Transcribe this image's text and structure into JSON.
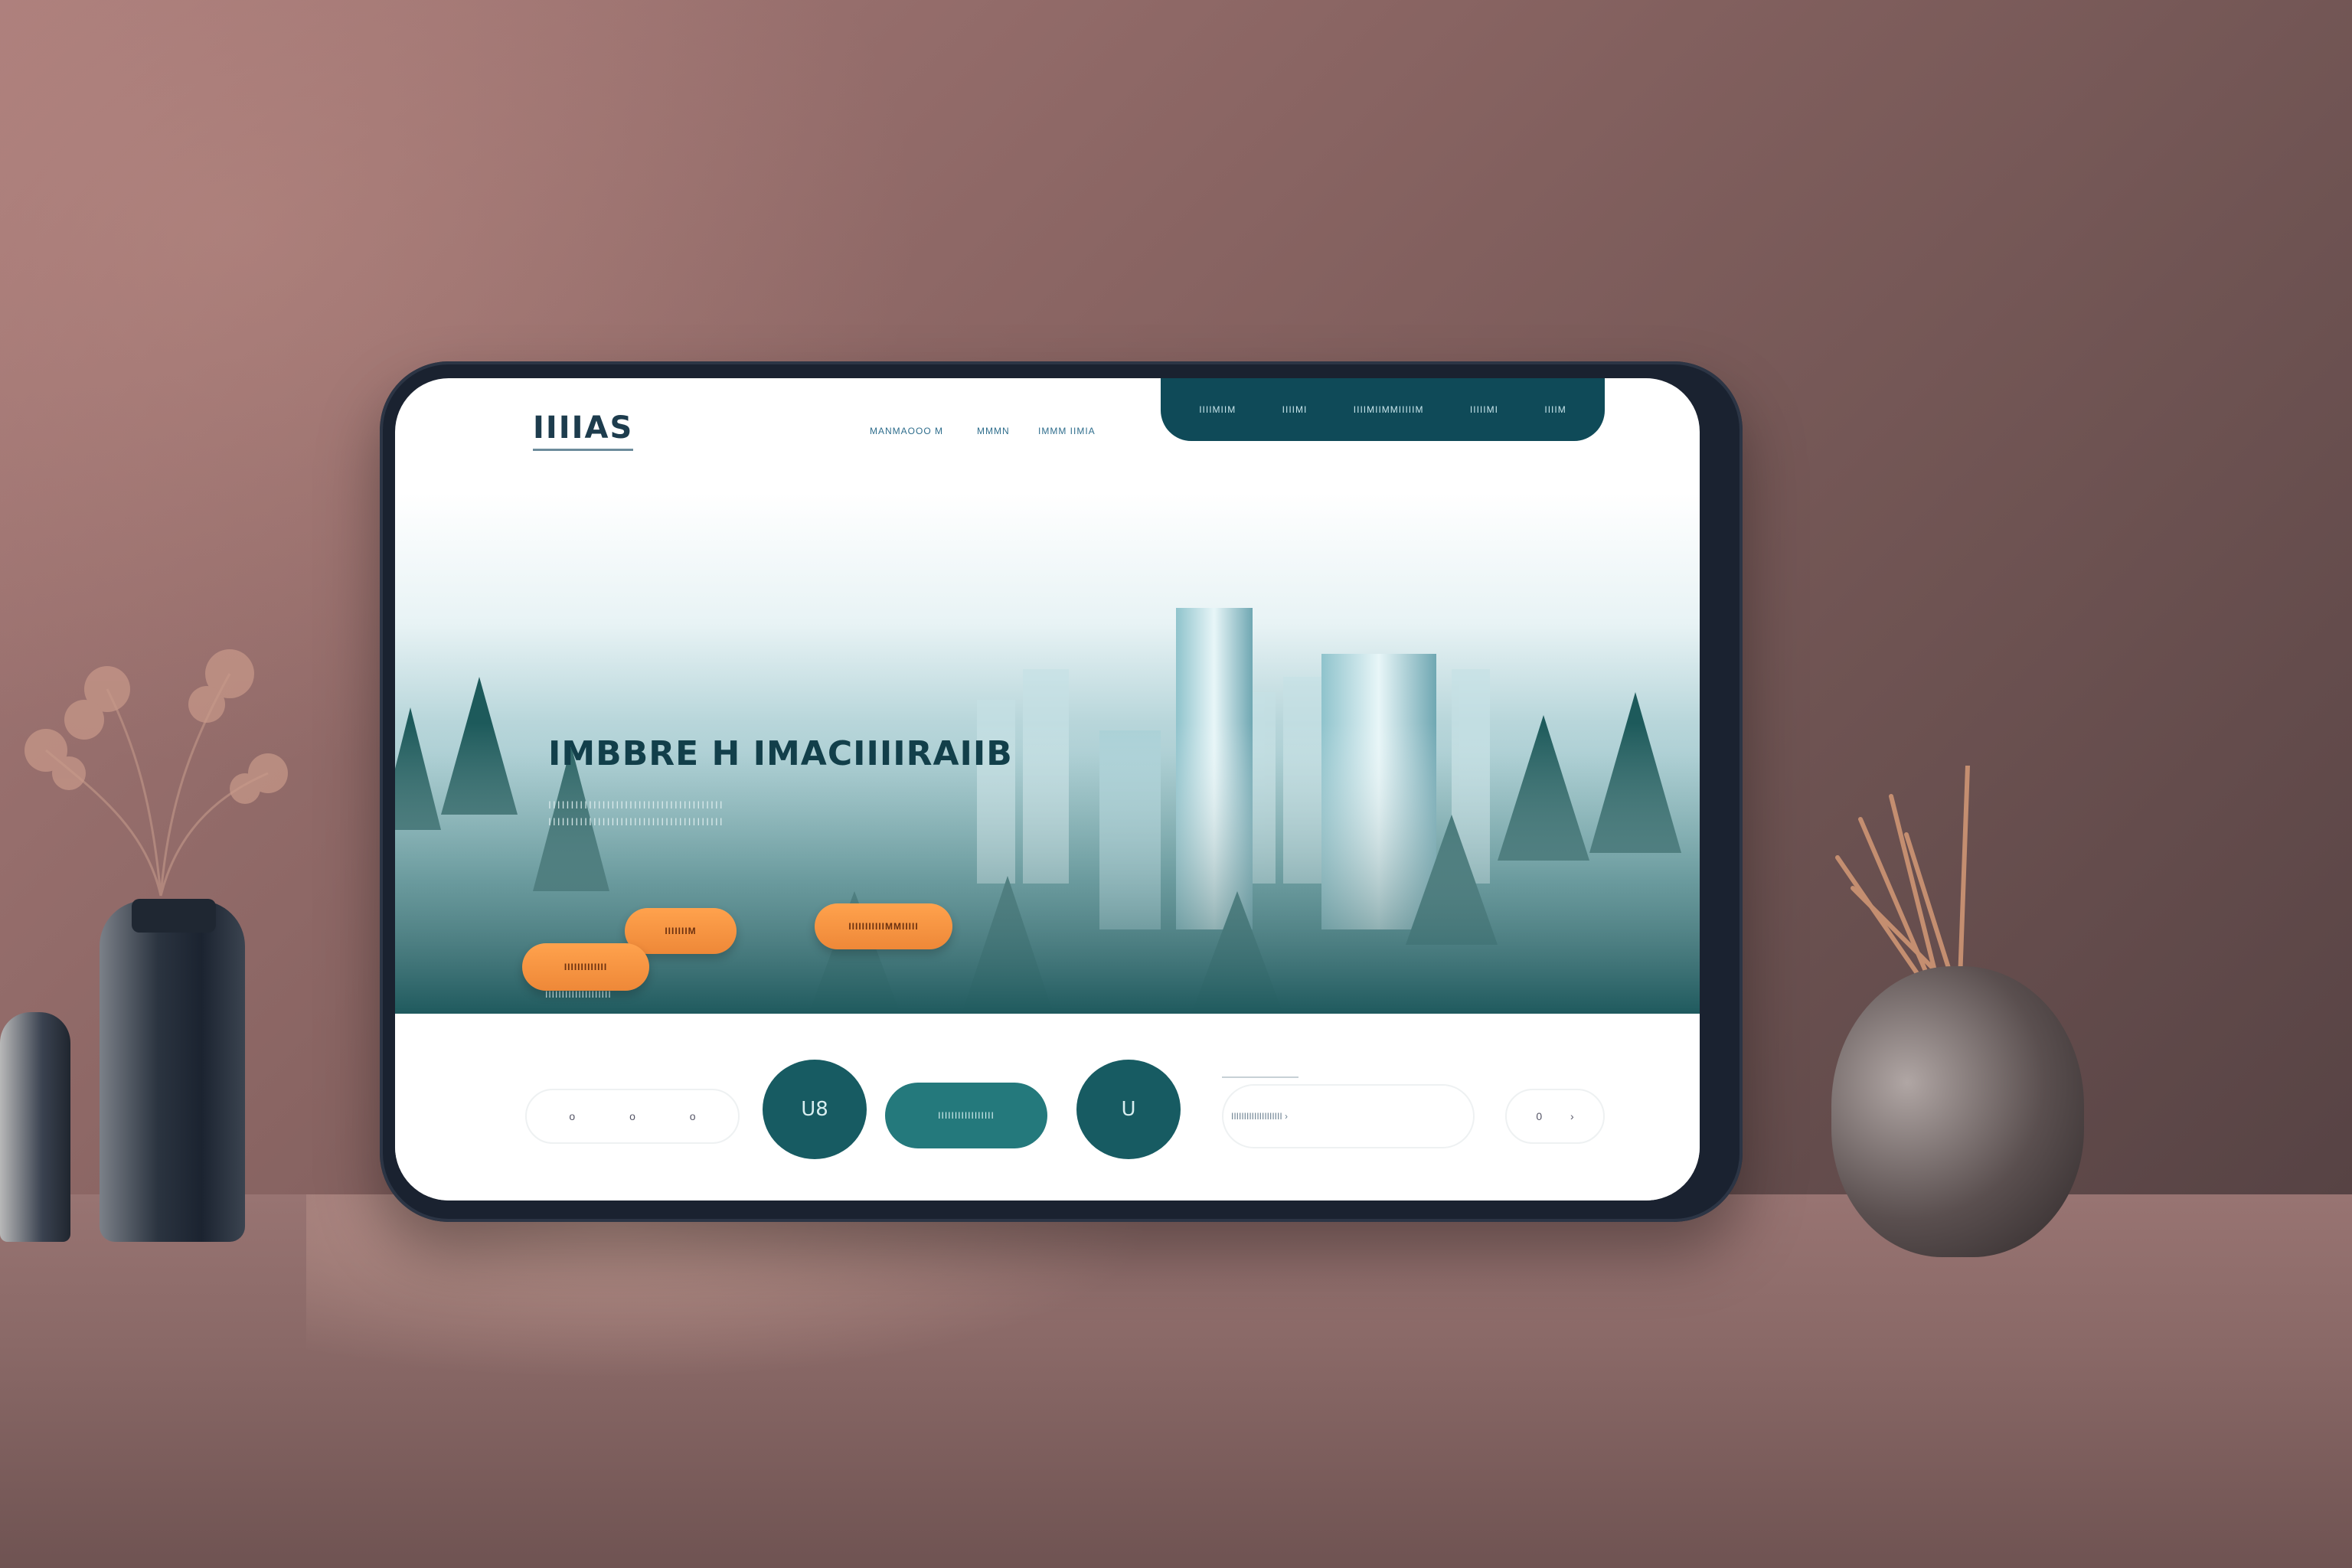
{
  "colors": {
    "wall": "#8a6563",
    "device_frame": "#1a2230",
    "nav_pill": "#0f4a58",
    "accent_orange": "#f39343",
    "accent_teal": "#175b62"
  },
  "header": {
    "logo": "IIIIAS",
    "nav_links": [
      "MANMAOOO M",
      "MMMN",
      "IMMM IIMIA"
    ],
    "pill_links": [
      "IIIIMIIM",
      "IIIIMI",
      "IIIIMIIMMIIIIIM",
      "IIIIIMI",
      "IIIIM"
    ]
  },
  "hero": {
    "title": "IMBBRE H IMACIIIIRAIIB",
    "subtitle_lines": [
      "IIIIIIIIIIIIIIIIIIIIIIIIIIIIIIIIIIIIIII",
      "IIIIIIIIIIIIIIIIIIIIIIIIIIIIIIIIIIIIIII"
    ],
    "button_1": "IIIIIIIM",
    "button_2": "IIIIIIIIIIIMMIIIII",
    "caption": "IIIIIIIIIIIIIIIIIIII",
    "button_3": "IIIIIIIIIIIII"
  },
  "bottom_bar": {
    "chip_1_icons": [
      "o",
      "o",
      "o"
    ],
    "circle_1_icon": "U8",
    "teal_pill_label": "IIIIIIIIIIIIIIIII",
    "circle_2_icon": "U",
    "search_placeholder": "IIIIIIIIIIIIIIIIIIII  ›",
    "chip_2_icons": [
      "0",
      "›"
    ]
  }
}
